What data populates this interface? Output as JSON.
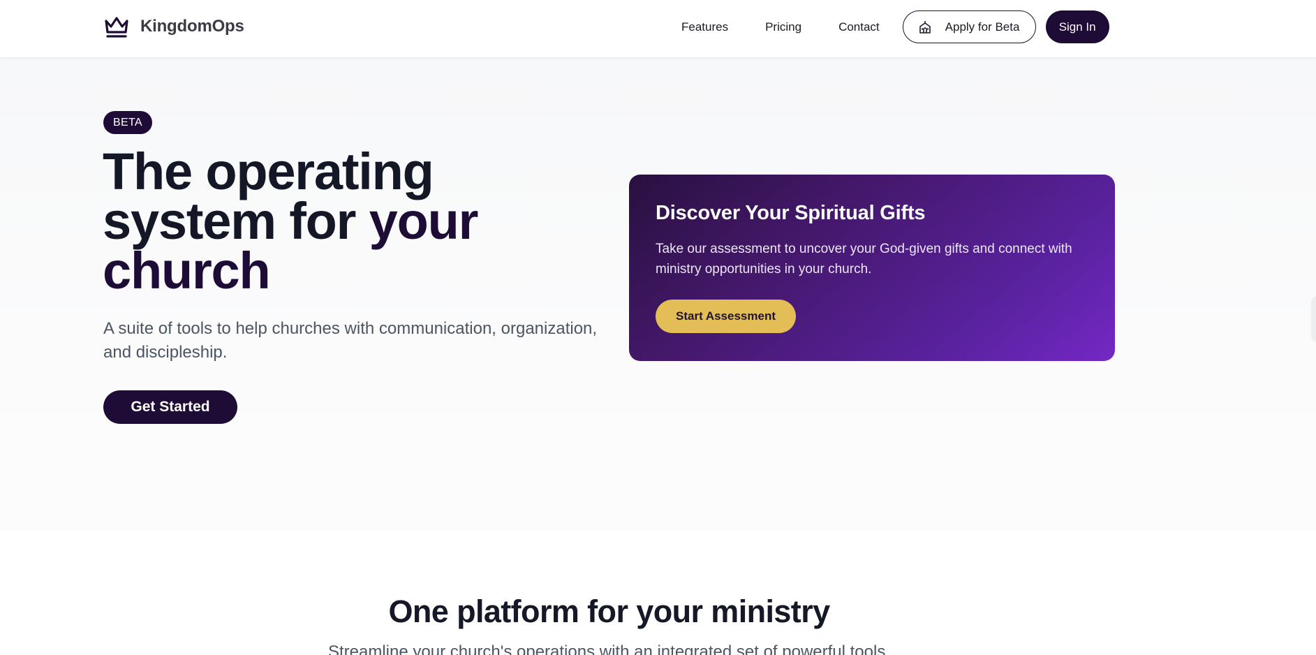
{
  "header": {
    "logo_text": "KingdomOps",
    "logo_icon": "crown-icon",
    "nav": [
      {
        "label": "Features"
      },
      {
        "label": "Pricing"
      },
      {
        "label": "Contact"
      }
    ],
    "apply_beta_label": "Apply for Beta",
    "apply_beta_icon": "church-icon",
    "sign_in_label": "Sign In"
  },
  "hero": {
    "badge": "BETA",
    "title_line1": "The operating",
    "title_line2a": "system for ",
    "title_line2b": "your",
    "title_line3": "church",
    "subtitle": "A suite of tools to help churches with communication, organization, and discipleship.",
    "cta_label": "Get Started"
  },
  "gifts_card": {
    "title": "Discover Your Spiritual Gifts",
    "text": "Take our assessment to uncover your God-given gifts and connect with ministry opportunities in your church.",
    "button_label": "Start Assessment"
  },
  "platform_section": {
    "title": "One platform for your ministry",
    "subtitle": "Streamline your church's operations with an integrated set of powerful tools."
  },
  "colors": {
    "brand_dark": "#1e0b36",
    "accent_gold": "#e3bd56",
    "card_purple": "#5a22a0"
  }
}
